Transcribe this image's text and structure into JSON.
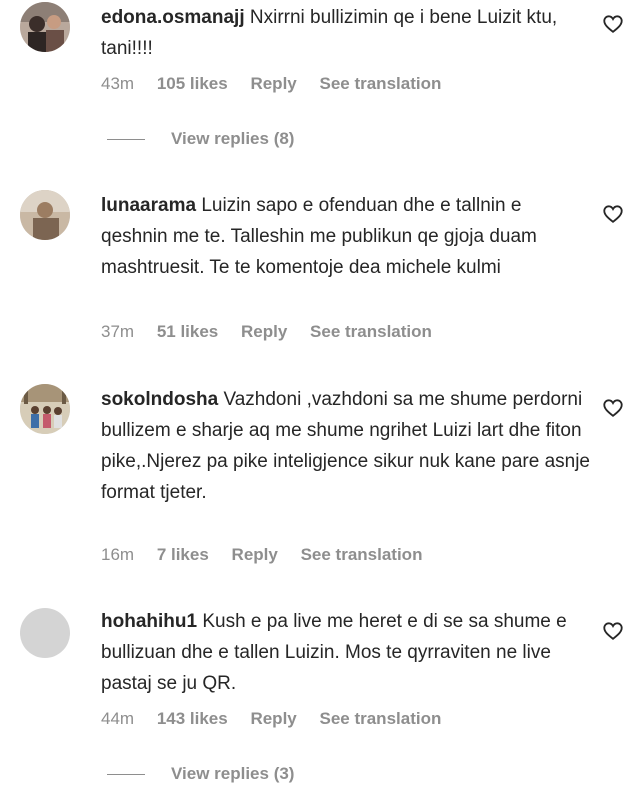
{
  "comments": [
    {
      "username": "edona.osmanajj",
      "text": "Nxirrni bullizimin qe i bene Luizit ktu, tani!!!!",
      "time": "43m",
      "likes": "105 likes",
      "reply": "Reply",
      "translation": "See translation",
      "view_replies": "View replies (8)"
    },
    {
      "username": "lunaarama",
      "text": "Luizin sapo e ofenduan dhe e tallnin e qeshnin me te. Talleshin me publikun qe gjoja duam mashtruesit. Te te komentoje dea michele kulmi",
      "time": "37m",
      "likes": "51 likes",
      "reply": "Reply",
      "translation": "See translation"
    },
    {
      "username": "sokolndosha",
      "text": "Vazhdoni ,vazhdoni sa me shume perdorni bullizem e sharje aq me shume ngrihet Luizi lart dhe fiton pike,.Njerez pa pike inteligjence sikur nuk kane pare asnje format tjeter.",
      "time": "16m",
      "likes": "7 likes",
      "reply": "Reply",
      "translation": "See translation"
    },
    {
      "username": "hohahihu1",
      "text": "Kush e pa live me heret e di se sa shume e bullizuan dhe e tallen Luizin. Mos te qyrraviten ne live pastaj se ju QR.",
      "time": "44m",
      "likes": "143 likes",
      "reply": "Reply",
      "translation": "See translation",
      "view_replies": "View replies (3)"
    }
  ],
  "colors": {
    "text": "#262626",
    "secondary": "#8e8e8e"
  },
  "icons": {
    "like": "heart-outline-icon"
  }
}
